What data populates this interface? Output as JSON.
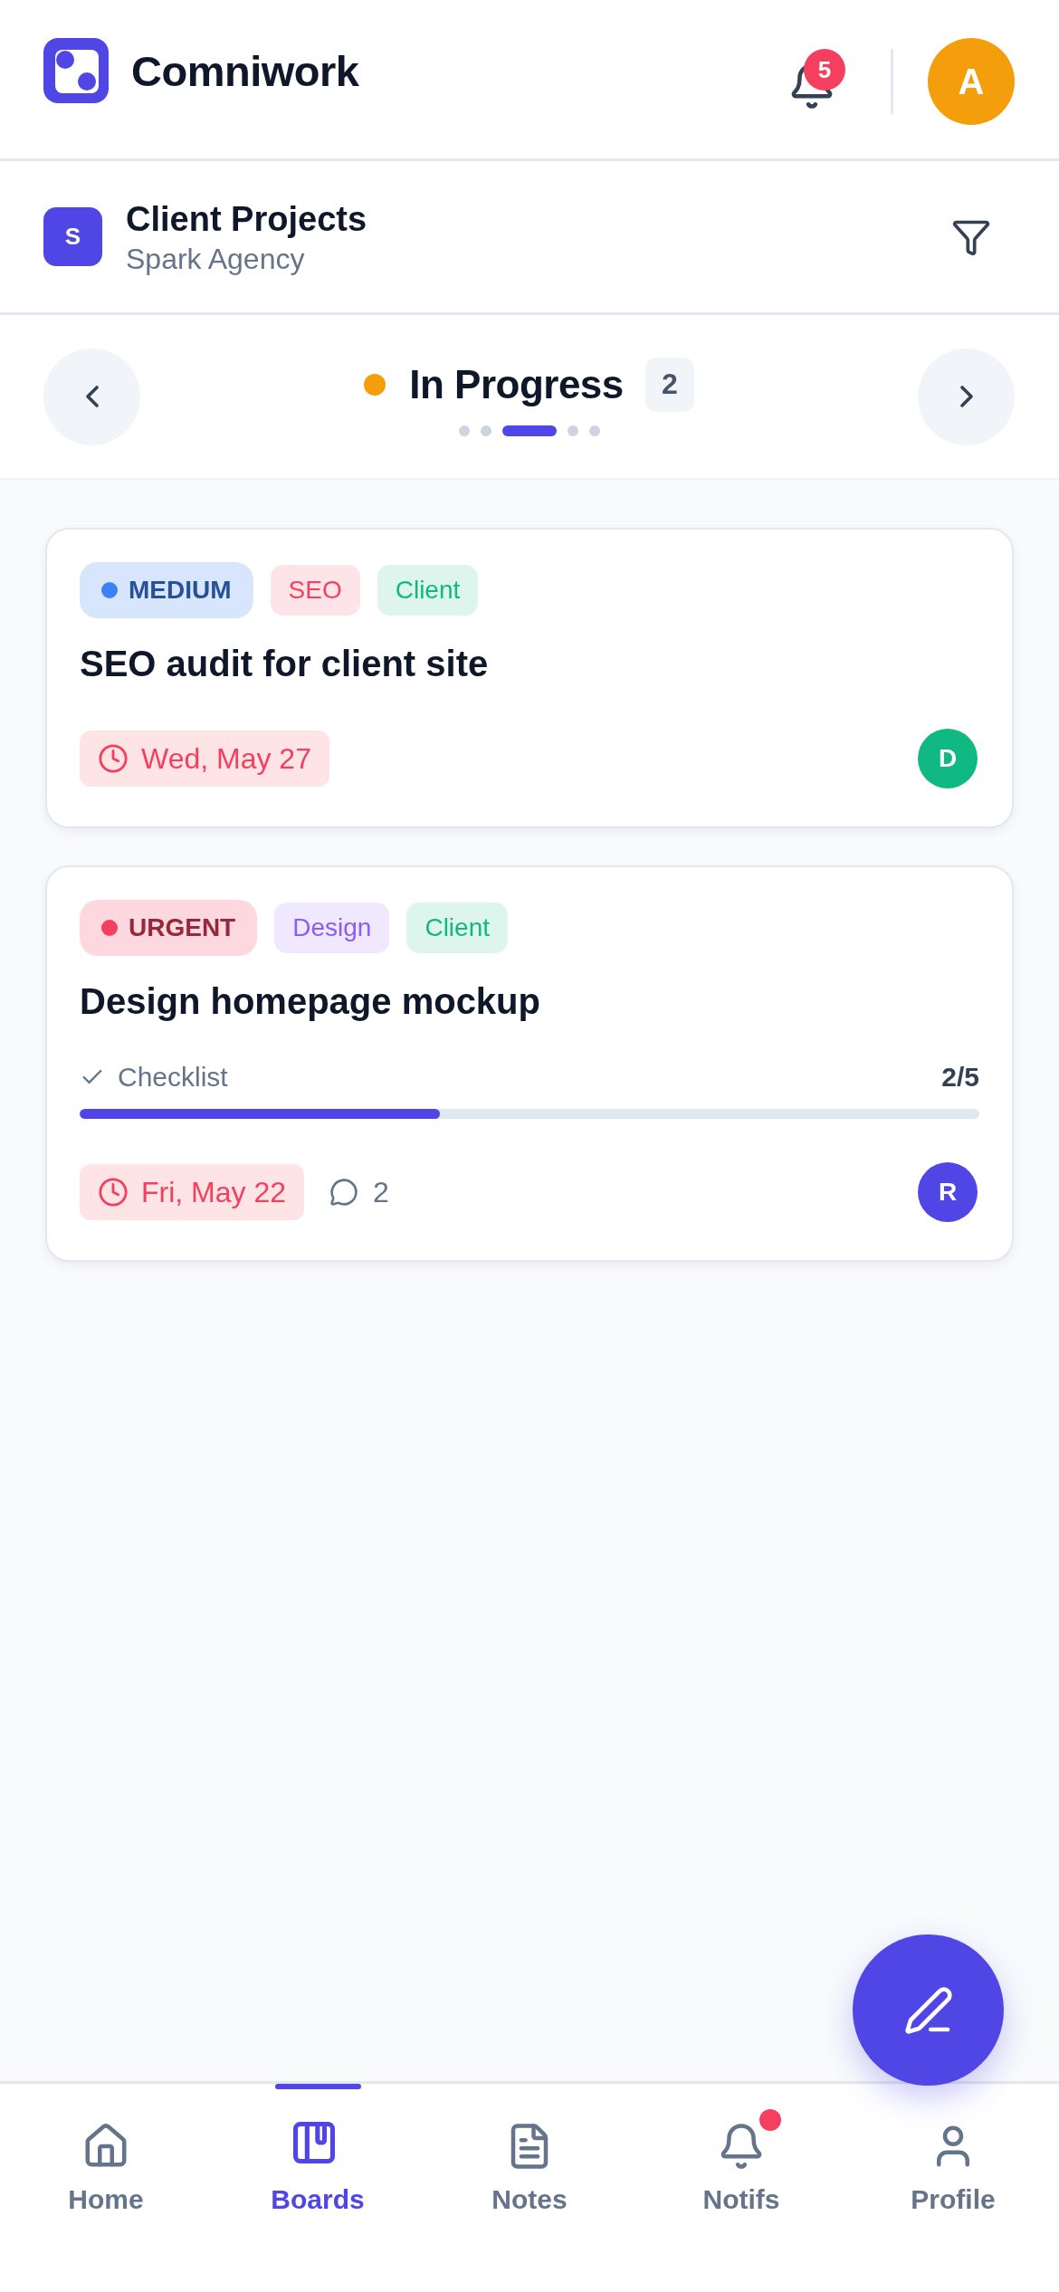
{
  "header": {
    "app_name": "Comniwork",
    "notification_count": "5",
    "avatar_initial": "A"
  },
  "board": {
    "workspace_initial": "S",
    "title": "Client Projects",
    "subtitle": "Spark Agency"
  },
  "column_nav": {
    "title": "In Progress",
    "count": "2",
    "pages": [
      {
        "selected": false
      },
      {
        "selected": false
      },
      {
        "selected": true
      },
      {
        "selected": false
      },
      {
        "selected": false
      }
    ]
  },
  "cards": [
    {
      "tags": [
        {
          "kind": "priority",
          "label": "MEDIUM",
          "color": "#3b82f6"
        },
        {
          "kind": "category",
          "label": "SEO",
          "color": "#f43f5e"
        },
        {
          "kind": "category",
          "label": "Client",
          "color": "#10b981"
        }
      ],
      "title": "SEO audit for client site",
      "due": "Wed, May 27",
      "assignee": {
        "initial": "D",
        "color": "#10b981"
      }
    },
    {
      "tags": [
        {
          "kind": "priority",
          "label": "URGENT",
          "color": "#f43f5e"
        },
        {
          "kind": "category",
          "label": "Design",
          "color": "#8b5cf6"
        },
        {
          "kind": "category",
          "label": "Client",
          "color": "#10b981"
        }
      ],
      "title": "Design homepage mockup",
      "checklist": {
        "label": "Checklist",
        "progress": "2/5",
        "level": 0.4
      },
      "due": "Fri, May 22",
      "comments": "2",
      "assignee": {
        "initial": "R",
        "color": "#4f46e5"
      }
    }
  ],
  "tab_bar": {
    "items": [
      {
        "kind": "home",
        "label": "Home",
        "selected": false,
        "unread": false
      },
      {
        "kind": "boards",
        "label": "Boards",
        "selected": true,
        "unread": false
      },
      {
        "kind": "notes",
        "label": "Notes",
        "selected": false,
        "unread": false
      },
      {
        "kind": "notifs",
        "label": "Notifs",
        "selected": false,
        "unread": true
      },
      {
        "kind": "profile",
        "label": "Profile",
        "selected": false,
        "unread": false
      }
    ]
  }
}
